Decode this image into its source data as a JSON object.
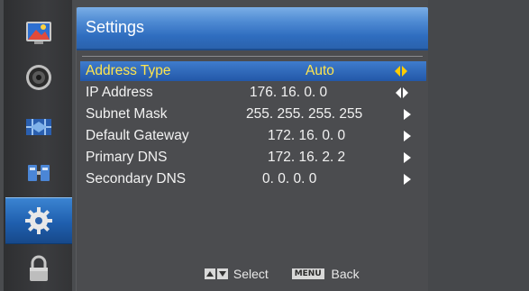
{
  "menu": {
    "title": "Settings",
    "rows": [
      {
        "label": "Address Type",
        "value": "Auto",
        "arrow": "left-right",
        "selected": true
      },
      {
        "label": "IP Address",
        "value": "176.   16.   0.   0",
        "arrow": "left-right",
        "selected": false
      },
      {
        "label": "Subnet Mask",
        "value": "255.  255.  255.  255",
        "arrow": "right",
        "selected": false
      },
      {
        "label": "Default Gateway",
        "value": "172.  16.  0.  0",
        "arrow": "right",
        "selected": false
      },
      {
        "label": "Primary DNS",
        "value": "172.  16.  2.  2",
        "arrow": "right",
        "selected": false
      },
      {
        "label": "Secondary DNS",
        "value": "0.    0.    0.    0",
        "arrow": "right",
        "selected": false
      }
    ]
  },
  "footer": {
    "select_label": "Select",
    "menu_key": "MENU",
    "back_label": "Back"
  },
  "sidebar": {
    "items": [
      {
        "icon": "picture-icon"
      },
      {
        "icon": "audio-icon"
      },
      {
        "icon": "channel-icon"
      },
      {
        "icon": "timer-icon"
      },
      {
        "icon": "settings-gear-icon",
        "active": true
      },
      {
        "icon": "lock-icon"
      }
    ]
  },
  "colors": {
    "selected_text": "#ffe54d",
    "highlight": "#2f6dbf",
    "arrow_selected": "#ffcc00"
  }
}
